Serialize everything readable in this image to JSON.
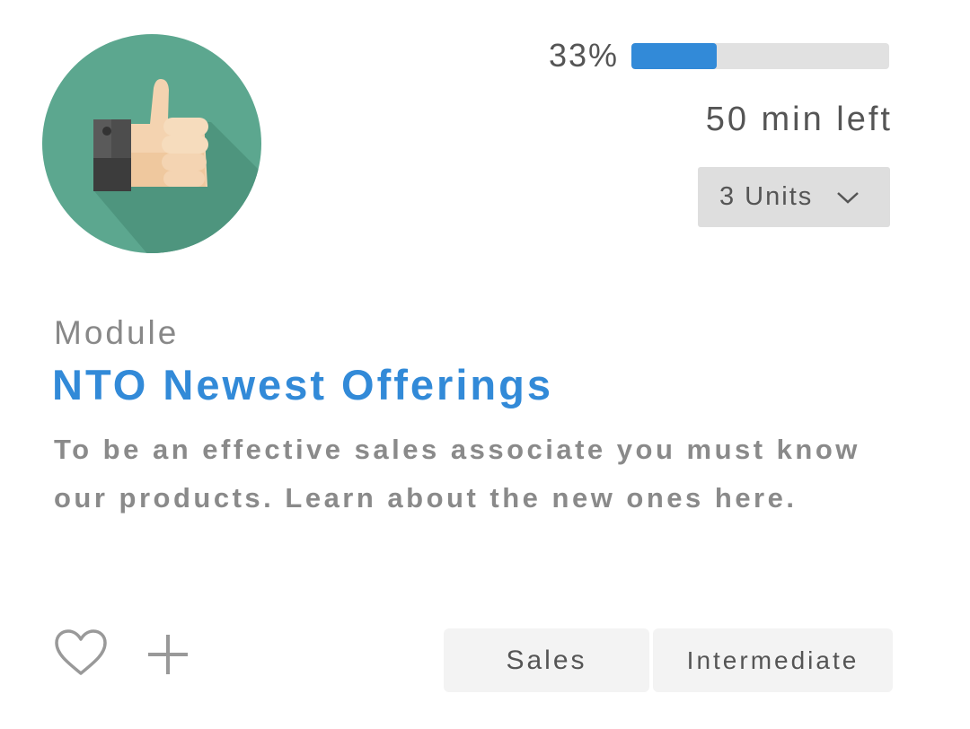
{
  "card": {
    "badge_icon": "thumbs-up-badge-icon",
    "progress": {
      "percent_label": "33%",
      "fraction": 0.33,
      "bar_color": "#328ad8",
      "track_color": "#e1e1e1"
    },
    "time_left": "50 min left",
    "units_dropdown": {
      "label": "3 Units",
      "icon": "chevron-down-icon"
    },
    "type": "Module",
    "title": "NTO Newest Offerings",
    "description": "To be an effective sales associate you must know our products. Learn about the new ones here.",
    "accent_color": "#328ad8",
    "actions": {
      "favorite_icon": "heart-icon",
      "add_icon": "plus-icon"
    },
    "tags": [
      "Sales",
      "Intermediate"
    ]
  }
}
